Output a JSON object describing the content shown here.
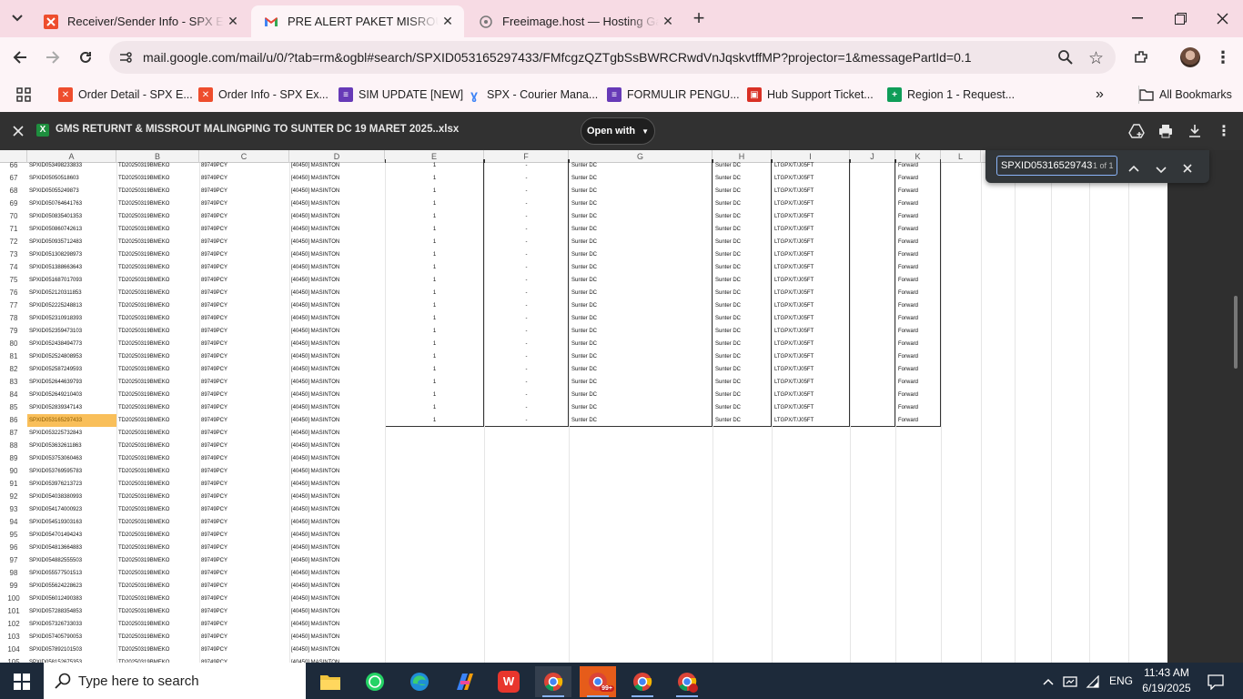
{
  "browser": {
    "tabs": [
      {
        "title": "Receiver/Sender Info - SPX Expr",
        "icon": "spx-x-icon",
        "active": false
      },
      {
        "title": "PRE ALERT PAKET MISROUTE &",
        "icon": "gmail-icon",
        "active": true
      },
      {
        "title": "Freeimage.host — Hosting Gam",
        "icon": "freeimage-icon",
        "active": false
      }
    ],
    "url": "mail.google.com/mail/u/0/?tab=rm&ogbl#search/SPXID053165297433/FMfcgzQZTgbSsBWRCRwdVnJqskvtffMP?projector=1&messagePartId=0.1",
    "bookmarks": [
      {
        "label": "Order Detail - SPX E...",
        "icon": "spx-x-icon",
        "color": "#ee4d2d"
      },
      {
        "label": "Order Info - SPX Ex...",
        "icon": "spx-x-icon",
        "color": "#ee4d2d"
      },
      {
        "label": "SIM UPDATE [NEW]",
        "icon": "forms-icon",
        "color": "#673ab7"
      },
      {
        "label": "SPX - Courier Mana...",
        "icon": "courier-icon",
        "color": "#3b82f6"
      },
      {
        "label": "FORMULIR PENGU...",
        "icon": "forms-icon",
        "color": "#673ab7"
      },
      {
        "label": "Hub Support Ticket...",
        "icon": "bag-icon",
        "color": "#d93025"
      },
      {
        "label": "Region 1 - Request...",
        "icon": "sheets-icon",
        "color": "#0f9d58"
      }
    ],
    "all_bookmarks_label": "All Bookmarks"
  },
  "viewer": {
    "filename": "GMS RETURNT & MISSROUT MALINGPING TO SUNTER DC 19 MARET 2025..xlsx",
    "open_with_label": "Open with"
  },
  "find": {
    "query": "SPXID05316529743",
    "count": "1 of 1"
  },
  "sheet": {
    "columns": [
      "A",
      "B",
      "C",
      "D",
      "E",
      "F",
      "G",
      "H",
      "I",
      "J",
      "K",
      "L"
    ],
    "highlight_row": "86",
    "rows": [
      {
        "n": "66",
        "a": "SPXID053498233833",
        "b": "TD20250319BMEKO",
        "c": "89749PCY",
        "d": "[40450] MASINTON",
        "e": "1",
        "f": "-",
        "g": "Sunter DC",
        "h": "Sunter DC",
        "i": "LTGPX/T/J05FT",
        "k": "Forward"
      },
      {
        "n": "67",
        "a": "SPXID05050518603",
        "b": "TD20250319BMEKO",
        "c": "89749PCY",
        "d": "[40450] MASINTON",
        "e": "1",
        "f": "-",
        "g": "Sunter DC",
        "h": "Sunter DC",
        "i": "LTGPX/T/J05FT",
        "k": "Forward"
      },
      {
        "n": "68",
        "a": "SPXID05055249873",
        "b": "TD20250319BMEKO",
        "c": "89749PCY",
        "d": "[40450] MASINTON",
        "e": "1",
        "f": "-",
        "g": "Sunter DC",
        "h": "Sunter DC",
        "i": "LTGPX/T/J05FT",
        "k": "Forward"
      },
      {
        "n": "69",
        "a": "SPXID050764641763",
        "b": "TD20250319BMEKO",
        "c": "89749PCY",
        "d": "[40450] MASINTON",
        "e": "1",
        "f": "-",
        "g": "Sunter DC",
        "h": "Sunter DC",
        "i": "LTGPX/T/J05FT",
        "k": "Forward"
      },
      {
        "n": "70",
        "a": "SPXID050835401353",
        "b": "TD20250319BMEKO",
        "c": "89749PCY",
        "d": "[40450] MASINTON",
        "e": "1",
        "f": "-",
        "g": "Sunter DC",
        "h": "Sunter DC",
        "i": "LTGPX/T/J05FT",
        "k": "Forward"
      },
      {
        "n": "71",
        "a": "SPXID050860742613",
        "b": "TD20250319BMEKO",
        "c": "89749PCY",
        "d": "[40450] MASINTON",
        "e": "1",
        "f": "-",
        "g": "Sunter DC",
        "h": "Sunter DC",
        "i": "LTGPX/T/J05FT",
        "k": "Forward"
      },
      {
        "n": "72",
        "a": "SPXID050935712483",
        "b": "TD20250319BMEKO",
        "c": "89749PCY",
        "d": "[40450] MASINTON",
        "e": "1",
        "f": "-",
        "g": "Sunter DC",
        "h": "Sunter DC",
        "i": "LTGPX/T/J05FT",
        "k": "Forward"
      },
      {
        "n": "73",
        "a": "SPXID051308298973",
        "b": "TD20250319BMEKO",
        "c": "89749PCY",
        "d": "[40450] MASINTON",
        "e": "1",
        "f": "-",
        "g": "Sunter DC",
        "h": "Sunter DC",
        "i": "LTGPX/T/J05FT",
        "k": "Forward"
      },
      {
        "n": "74",
        "a": "SPXID051388663643",
        "b": "TD20250319BMEKO",
        "c": "89749PCY",
        "d": "[40450] MASINTON",
        "e": "1",
        "f": "-",
        "g": "Sunter DC",
        "h": "Sunter DC",
        "i": "LTGPX/T/J05FT",
        "k": "Forward"
      },
      {
        "n": "75",
        "a": "SPXID051687017093",
        "b": "TD20250319BMEKO",
        "c": "89749PCY",
        "d": "[40450] MASINTON",
        "e": "1",
        "f": "-",
        "g": "Sunter DC",
        "h": "Sunter DC",
        "i": "LTGPX/T/J05FT",
        "k": "Forward"
      },
      {
        "n": "76",
        "a": "SPXID052120311853",
        "b": "TD20250319BMEKO",
        "c": "89749PCY",
        "d": "[40450] MASINTON",
        "e": "1",
        "f": "-",
        "g": "Sunter DC",
        "h": "Sunter DC",
        "i": "LTGPX/T/J05FT",
        "k": "Forward"
      },
      {
        "n": "77",
        "a": "SPXID052225248813",
        "b": "TD20250319BMEKO",
        "c": "89749PCY",
        "d": "[40450] MASINTON",
        "e": "1",
        "f": "-",
        "g": "Sunter DC",
        "h": "Sunter DC",
        "i": "LTGPX/T/J05FT",
        "k": "Forward"
      },
      {
        "n": "78",
        "a": "SPXID052310918393",
        "b": "TD20250319BMEKO",
        "c": "89749PCY",
        "d": "[40450] MASINTON",
        "e": "1",
        "f": "-",
        "g": "Sunter DC",
        "h": "Sunter DC",
        "i": "LTGPX/T/J05FT",
        "k": "Forward"
      },
      {
        "n": "79",
        "a": "SPXID052359473103",
        "b": "TD20250319BMEKO",
        "c": "89749PCY",
        "d": "[40450] MASINTON",
        "e": "1",
        "f": "-",
        "g": "Sunter DC",
        "h": "Sunter DC",
        "i": "LTGPX/T/J05FT",
        "k": "Forward"
      },
      {
        "n": "80",
        "a": "SPXID052438494773",
        "b": "TD20250319BMEKO",
        "c": "89749PCY",
        "d": "[40450] MASINTON",
        "e": "1",
        "f": "-",
        "g": "Sunter DC",
        "h": "Sunter DC",
        "i": "LTGPX/T/J05FT",
        "k": "Forward"
      },
      {
        "n": "81",
        "a": "SPXID052524808953",
        "b": "TD20250319BMEKO",
        "c": "89749PCY",
        "d": "[40450] MASINTON",
        "e": "1",
        "f": "-",
        "g": "Sunter DC",
        "h": "Sunter DC",
        "i": "LTGPX/T/J05FT",
        "k": "Forward"
      },
      {
        "n": "82",
        "a": "SPXID052587249593",
        "b": "TD20250319BMEKO",
        "c": "89749PCY",
        "d": "[40450] MASINTON",
        "e": "1",
        "f": "-",
        "g": "Sunter DC",
        "h": "Sunter DC",
        "i": "LTGPX/T/J05FT",
        "k": "Forward"
      },
      {
        "n": "83",
        "a": "SPXID052644639793",
        "b": "TD20250319BMEKO",
        "c": "89749PCY",
        "d": "[40450] MASINTON",
        "e": "1",
        "f": "-",
        "g": "Sunter DC",
        "h": "Sunter DC",
        "i": "LTGPX/T/J05FT",
        "k": "Forward"
      },
      {
        "n": "84",
        "a": "SPXID052649210403",
        "b": "TD20250319BMEKO",
        "c": "89749PCY",
        "d": "[40450] MASINTON",
        "e": "1",
        "f": "-",
        "g": "Sunter DC",
        "h": "Sunter DC",
        "i": "LTGPX/T/J05FT",
        "k": "Forward"
      },
      {
        "n": "85",
        "a": "SPXID052839347143",
        "b": "TD20250319BMEKO",
        "c": "89749PCY",
        "d": "[40450] MASINTON",
        "e": "1",
        "f": "-",
        "g": "Sunter DC",
        "h": "Sunter DC",
        "i": "LTGPX/T/J05FT",
        "k": "Forward"
      },
      {
        "n": "86",
        "a": "SPXID053165297433",
        "b": "TD20250319BMEKO",
        "c": "89749PCY",
        "d": "[40450] MASINTON",
        "e": "1",
        "f": "-",
        "g": "Sunter DC",
        "h": "Sunter DC",
        "i": "LTGPX/T/J05FT",
        "k": "Forward"
      },
      {
        "n": "87",
        "a": "SPXID053225732843",
        "b": "TD20250319BMEKO",
        "c": "89749PCY",
        "d": "[40450] MASINTON"
      },
      {
        "n": "88",
        "a": "SPXID053632611863",
        "b": "TD20250319BMEKO",
        "c": "89749PCY",
        "d": "[40450] MASINTON"
      },
      {
        "n": "89",
        "a": "SPXID053753060463",
        "b": "TD20250319BMEKO",
        "c": "89749PCY",
        "d": "[40450] MASINTON"
      },
      {
        "n": "90",
        "a": "SPXID053769595783",
        "b": "TD20250319BMEKO",
        "c": "89749PCY",
        "d": "[40450] MASINTON"
      },
      {
        "n": "91",
        "a": "SPXID053976213723",
        "b": "TD20250319BMEKO",
        "c": "89749PCY",
        "d": "[40450] MASINTON"
      },
      {
        "n": "92",
        "a": "SPXID054038380993",
        "b": "TD20250319BMEKO",
        "c": "89749PCY",
        "d": "[40450] MASINTON"
      },
      {
        "n": "93",
        "a": "SPXID054174000923",
        "b": "TD20250319BMEKO",
        "c": "89749PCY",
        "d": "[40450] MASINTON"
      },
      {
        "n": "94",
        "a": "SPXID054519303163",
        "b": "TD20250319BMEKO",
        "c": "89749PCY",
        "d": "[40450] MASINTON"
      },
      {
        "n": "95",
        "a": "SPXID054701494243",
        "b": "TD20250319BMEKO",
        "c": "89749PCY",
        "d": "[40450] MASINTON"
      },
      {
        "n": "96",
        "a": "SPXID054813664883",
        "b": "TD20250319BMEKO",
        "c": "89749PCY",
        "d": "[40450] MASINTON"
      },
      {
        "n": "97",
        "a": "SPXID054882555503",
        "b": "TD20250319BMEKO",
        "c": "89749PCY",
        "d": "[40450] MASINTON"
      },
      {
        "n": "98",
        "a": "SPXID055577501513",
        "b": "TD20250319BMEKO",
        "c": "89749PCY",
        "d": "[40450] MASINTON"
      },
      {
        "n": "99",
        "a": "SPXID055624228623",
        "b": "TD20250319BMEKO",
        "c": "89749PCY",
        "d": "[40450] MASINTON"
      },
      {
        "n": "100",
        "a": "SPXID056012490383",
        "b": "TD20250319BMEKO",
        "c": "89749PCY",
        "d": "[40450] MASINTON"
      },
      {
        "n": "101",
        "a": "SPXID057288354853",
        "b": "TD20250319BMEKO",
        "c": "89749PCY",
        "d": "[40450] MASINTON"
      },
      {
        "n": "102",
        "a": "SPXID057326733033",
        "b": "TD20250319BMEKO",
        "c": "89749PCY",
        "d": "[40450] MASINTON"
      },
      {
        "n": "103",
        "a": "SPXID057405790053",
        "b": "TD20250319BMEKO",
        "c": "89749PCY",
        "d": "[40450] MASINTON"
      },
      {
        "n": "104",
        "a": "SPXID057892101503",
        "b": "TD20250319BMEKO",
        "c": "89749PCY",
        "d": "[40450] MASINTON"
      },
      {
        "n": "105",
        "a": "SPXID058152675353",
        "b": "TD20250319BMEKO",
        "c": "89749PCY",
        "d": "[40450] MASINTON"
      }
    ]
  },
  "taskbar": {
    "search_placeholder": "Type here to search",
    "badge": "99+",
    "language": "ENG",
    "time": "11:43 AM",
    "date": "6/19/2025",
    "apps": [
      "file-explorer-icon",
      "whatsapp-icon",
      "edge-icon",
      "copilot-icon",
      "wps-icon",
      "chrome-icon",
      "chrome-badge-icon",
      "chrome-icon",
      "chrome-profile-icon"
    ]
  },
  "colors": {
    "tabstrip": "#f7dbe4",
    "toolbar": "#fdf4f7",
    "viewer_bar": "#313131",
    "highlight": "#f9bf5a"
  }
}
